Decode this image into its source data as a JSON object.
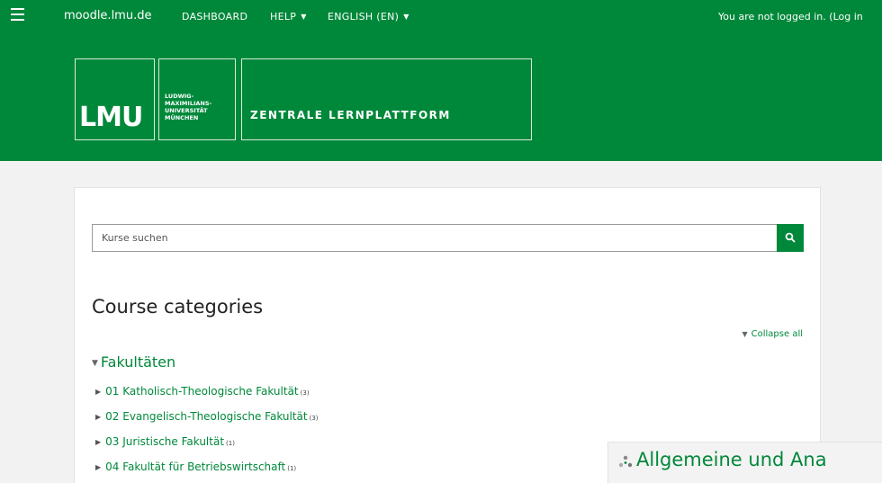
{
  "topnav": {
    "site_name": "moodle.lmu.de",
    "dashboard_label": "DASHBOARD",
    "help_label": "HELP",
    "language_label": "ENGLISH (EN)",
    "login_text": "You are not logged in. (Log in"
  },
  "banner": {
    "logo_text": "LMU",
    "university_lines": [
      "LUDWIG-",
      "MAXIMILIANS-",
      "UNIVERSITÄT",
      "MÜNCHEN"
    ],
    "platform_title": "ZENTRALE LERNPLATTFORM"
  },
  "search": {
    "placeholder": "Kurse suchen"
  },
  "main": {
    "heading": "Course categories",
    "collapse_label": "Collapse all",
    "category": {
      "name": "Fakultäten",
      "subcategories": [
        {
          "label": "01 Katholisch-Theologische Fakultät",
          "count": "(3)"
        },
        {
          "label": "02 Evangelisch-Theologische Fakultät",
          "count": "(3)"
        },
        {
          "label": "03 Juristische Fakultät",
          "count": "(1)"
        },
        {
          "label": "04 Fakultät für Betriebswirtschaft",
          "count": "(1)"
        }
      ]
    }
  },
  "overlay": {
    "title": "Allgemeine und Ana"
  },
  "colors": {
    "brand": "#00883a",
    "background": "#f2f2f2"
  }
}
